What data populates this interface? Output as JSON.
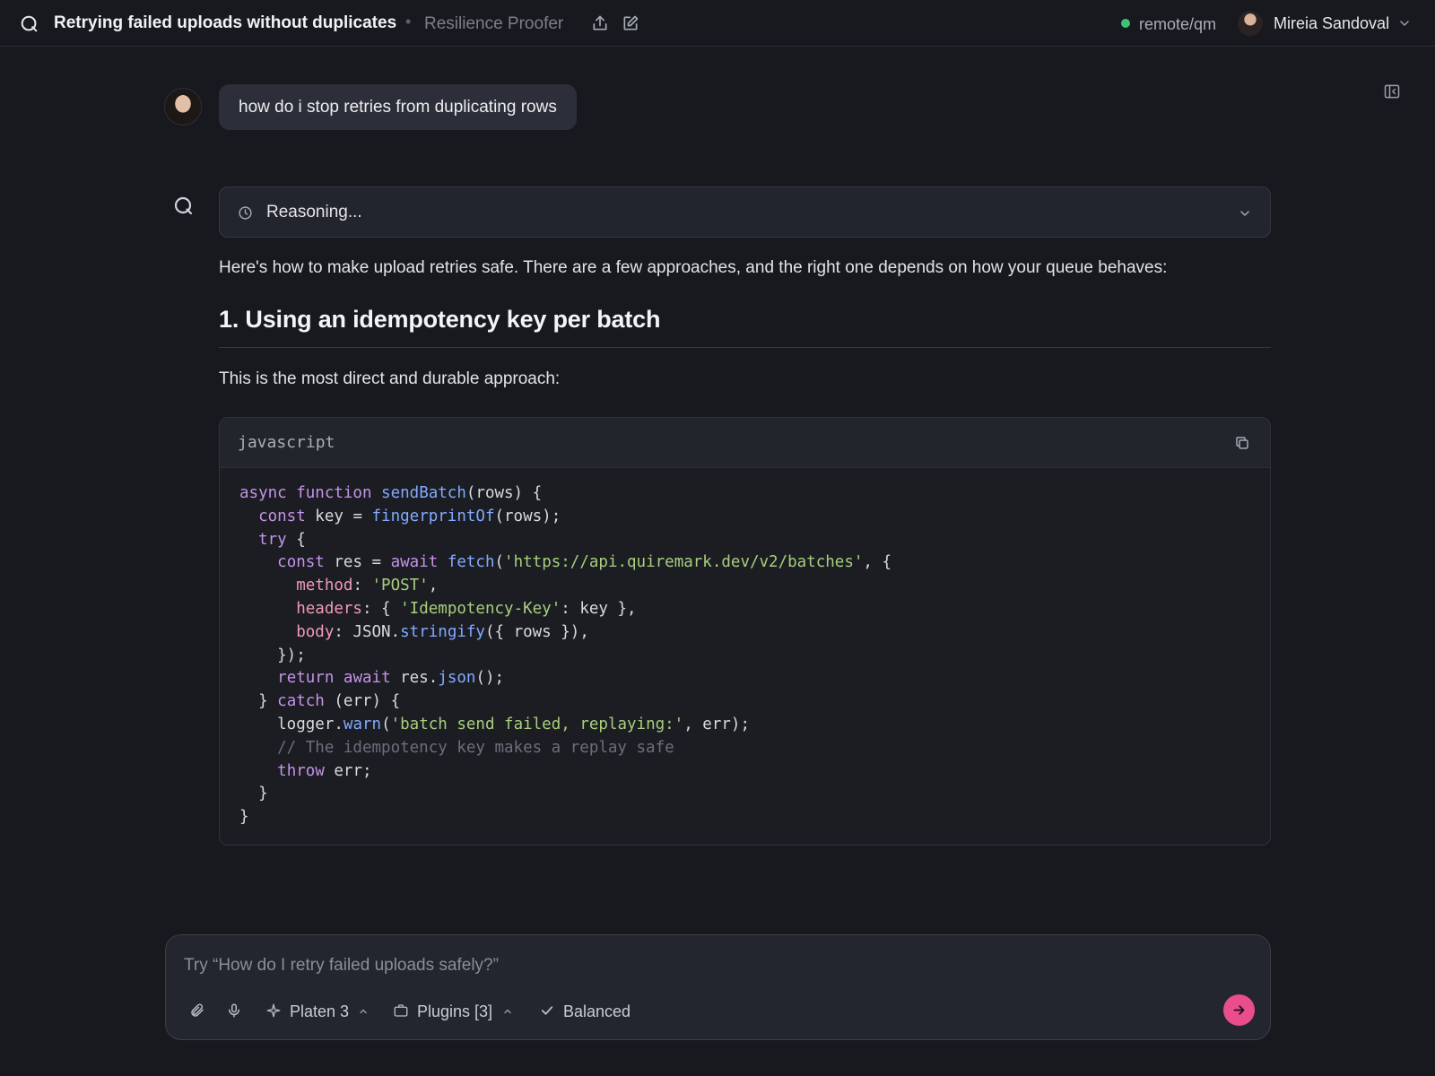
{
  "topbar": {
    "title": "Retrying failed uploads without duplicates",
    "separator": "•",
    "subtitle": "Resilience Proofer",
    "remote_label": "remote/qm",
    "remote_status_color": "#3ec27a",
    "user_name": "Mireia Sandoval"
  },
  "conversation": {
    "user_message": "how do i stop retries from duplicating rows",
    "reasoning_label": "Reasoning...",
    "intro": "Here's how to make upload retries safe. There are a few approaches, and the right one depends on how your queue behaves:",
    "section_heading": "1. Using an idempotency key per batch",
    "section_paragraph": "This is the most direct and durable approach:",
    "code": {
      "language": "javascript",
      "lines": [
        [
          [
            "kw",
            "async "
          ],
          [
            "kw",
            "function "
          ],
          [
            "fn",
            "sendBatch"
          ],
          [
            "pl",
            "(rows) {"
          ]
        ],
        [
          [
            "pl",
            "  "
          ],
          [
            "kw",
            "const "
          ],
          [
            "pl",
            "key = "
          ],
          [
            "fn",
            "fingerprintOf"
          ],
          [
            "pl",
            "(rows);"
          ]
        ],
        [
          [
            "pl",
            "  "
          ],
          [
            "kw",
            "try "
          ],
          [
            "pl",
            "{"
          ]
        ],
        [
          [
            "pl",
            "    "
          ],
          [
            "kw",
            "const "
          ],
          [
            "pl",
            "res = "
          ],
          [
            "kw",
            "await "
          ],
          [
            "fn",
            "fetch"
          ],
          [
            "pl",
            "("
          ],
          [
            "str",
            "'https://api.quiremark.dev/v2/batches'"
          ],
          [
            "pl",
            ", {"
          ]
        ],
        [
          [
            "pl",
            "      "
          ],
          [
            "prop",
            "method"
          ],
          [
            "pl",
            ": "
          ],
          [
            "str",
            "'POST'"
          ],
          [
            "pl",
            ","
          ]
        ],
        [
          [
            "pl",
            "      "
          ],
          [
            "prop",
            "headers"
          ],
          [
            "pl",
            ": { "
          ],
          [
            "str",
            "'Idempotency-Key'"
          ],
          [
            "pl",
            ": key },"
          ]
        ],
        [
          [
            "pl",
            "      "
          ],
          [
            "prop",
            "body"
          ],
          [
            "pl",
            ": JSON."
          ],
          [
            "fn",
            "stringify"
          ],
          [
            "pl",
            "({ rows }),"
          ]
        ],
        [
          [
            "pl",
            "    });"
          ]
        ],
        [
          [
            "pl",
            "    "
          ],
          [
            "kw",
            "return "
          ],
          [
            "kw",
            "await "
          ],
          [
            "pl",
            "res."
          ],
          [
            "fn",
            "json"
          ],
          [
            "pl",
            "();"
          ]
        ],
        [
          [
            "pl",
            "  } "
          ],
          [
            "kw",
            "catch "
          ],
          [
            "pl",
            "(err) {"
          ]
        ],
        [
          [
            "pl",
            "    logger."
          ],
          [
            "fn",
            "warn"
          ],
          [
            "pl",
            "("
          ],
          [
            "str",
            "'batch send failed, replaying:'"
          ],
          [
            "pl",
            ", err);"
          ]
        ],
        [
          [
            "cmt",
            "    // The idempotency key makes a replay safe"
          ]
        ],
        [
          [
            "pl",
            "    "
          ],
          [
            "kw",
            "throw "
          ],
          [
            "pl",
            "err;"
          ]
        ],
        [
          [
            "pl",
            "  }"
          ]
        ],
        [
          [
            "pl",
            "}"
          ]
        ]
      ]
    }
  },
  "composer": {
    "placeholder": "Try “How do I retry failed uploads safely?”",
    "model_label": "Platen 3",
    "plugins_label": "Plugins [3]",
    "mode_label": "Balanced",
    "send_color": "#ea4d8c"
  },
  "icons": {
    "app_logo": "q-logo-icon",
    "share": "share-icon",
    "edit": "edit-icon",
    "sidebar_toggle": "panel-toggle-icon",
    "reasoning": "clock-icon",
    "copy": "copy-icon",
    "attach": "paperclip-icon",
    "mic": "microphone-icon",
    "model": "sparkle-icon",
    "plugins": "briefcase-icon",
    "mode": "check-icon",
    "send": "arrow-right-icon"
  }
}
